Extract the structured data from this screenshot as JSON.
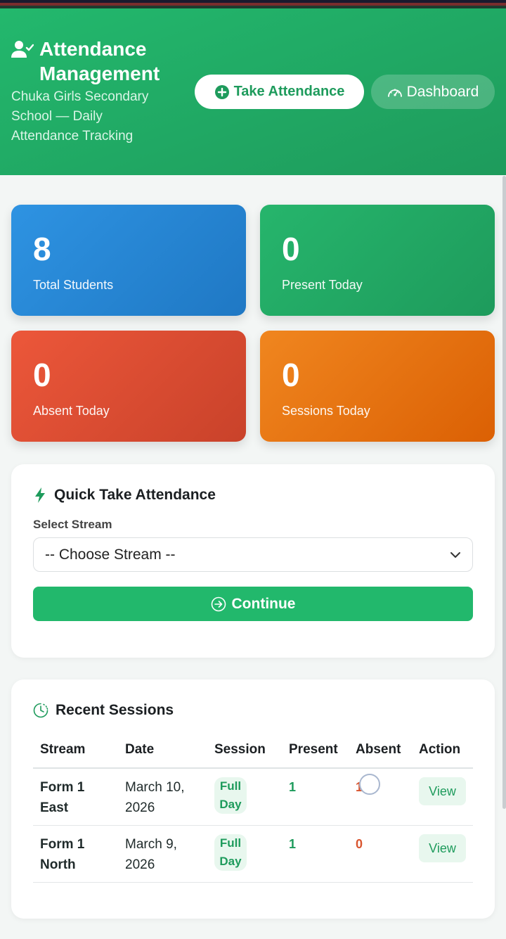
{
  "header": {
    "title_line1": "Attendance",
    "title_line2": "Management",
    "subtitle": "Chuka Girls Secondary School — Daily Attendance Tracking",
    "take_attendance_label": "Take Attendance",
    "dashboard_label": "Dashboard"
  },
  "stats": [
    {
      "value": "8",
      "label": "Total Students",
      "color": "#2e93e2"
    },
    {
      "value": "0",
      "label": "Present Today",
      "color": "#26b56c"
    },
    {
      "value": "0",
      "label": "Absent Today",
      "color": "#ec573a"
    },
    {
      "value": "0",
      "label": "Sessions Today",
      "color": "#f0861f"
    }
  ],
  "quick": {
    "title": "Quick Take Attendance",
    "field_label": "Select Stream",
    "select_value": "-- Choose Stream --",
    "continue_label": "Continue"
  },
  "recent": {
    "title": "Recent Sessions",
    "columns": [
      "Stream",
      "Date",
      "Session",
      "Present",
      "Absent",
      "Action"
    ],
    "rows": [
      {
        "stream": "Form 1 East",
        "date": "March 10, 2026",
        "session": "Full Day",
        "present": "1",
        "absent": "1",
        "action": "View"
      },
      {
        "stream": "Form 1 North",
        "date": "March 9, 2026",
        "session": "Full Day",
        "present": "1",
        "absent": "0",
        "action": "View"
      }
    ]
  },
  "icons": {
    "header": "user-check-icon",
    "take_attendance": "plus-circle-icon",
    "dashboard": "speedometer-icon",
    "quick": "lightning-icon",
    "continue": "arrow-circle-right-icon",
    "recent": "clock-icon",
    "select": "chevron-down-icon"
  },
  "colors": {
    "brand": "#1e9b5c",
    "brand_light": "#23b86d",
    "absent": "#d9552f"
  }
}
